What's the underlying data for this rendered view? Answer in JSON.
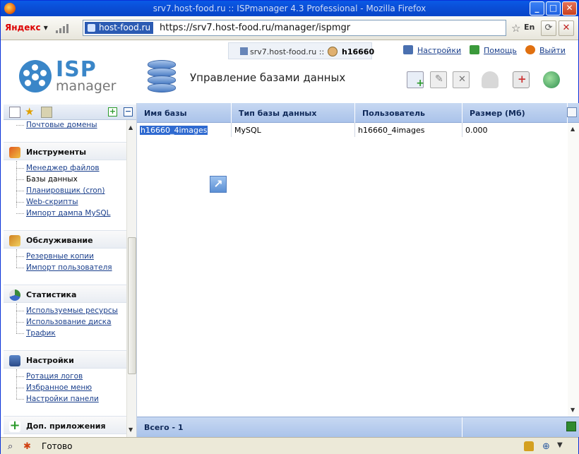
{
  "browser": {
    "window_title": "srv7.host-food.ru :: ISPmanager 4.3 Professional - Mozilla Firefox",
    "yandex_label": "Яндекс",
    "site_badge": "host-food.ru",
    "url": "https://srv7.host-food.ru/manager/ispmgr",
    "status_text": "Готово",
    "lang_badge": "En"
  },
  "header": {
    "host": "srv7.host-food.ru ::",
    "user": "h16660",
    "links": [
      "Настройки",
      "Помощь",
      "Выйти"
    ],
    "logo_isp": "ISP",
    "logo_manager": "manager",
    "page_title": "Управление базами данных"
  },
  "sidebar": {
    "top_item": "Почтовые домены",
    "groups": [
      {
        "title": "Инструменты",
        "items": [
          "Менеджер файлов",
          "Базы данных",
          "Планировщик (cron)",
          "Web-скрипты",
          "Импорт дампа MySQL"
        ]
      },
      {
        "title": "Обслуживание",
        "items": [
          "Резервные копии",
          "Импорт пользователя"
        ]
      },
      {
        "title": "Статистика",
        "items": [
          "Используемые ресурсы",
          "Использование диска",
          "Трафик"
        ]
      },
      {
        "title": "Настройки",
        "items": [
          "Ротация логов",
          "Избранное меню",
          "Настройки панели"
        ]
      },
      {
        "title": "Доп. приложения",
        "items": []
      }
    ],
    "current_item": "Базы данных"
  },
  "table": {
    "columns": [
      "Имя базы",
      "Тип базы данных",
      "Пользователь",
      "Размер (Мб)"
    ],
    "rows": [
      [
        "h16660_4images",
        "MySQL",
        "h16660_4images",
        "0.000"
      ]
    ],
    "footer": "Всего - 1"
  },
  "colors": {
    "titlebar": "#0a4fd8",
    "table_header": "#aac3ea",
    "link": "#1a3f8c",
    "selection": "#2f6ad0"
  }
}
